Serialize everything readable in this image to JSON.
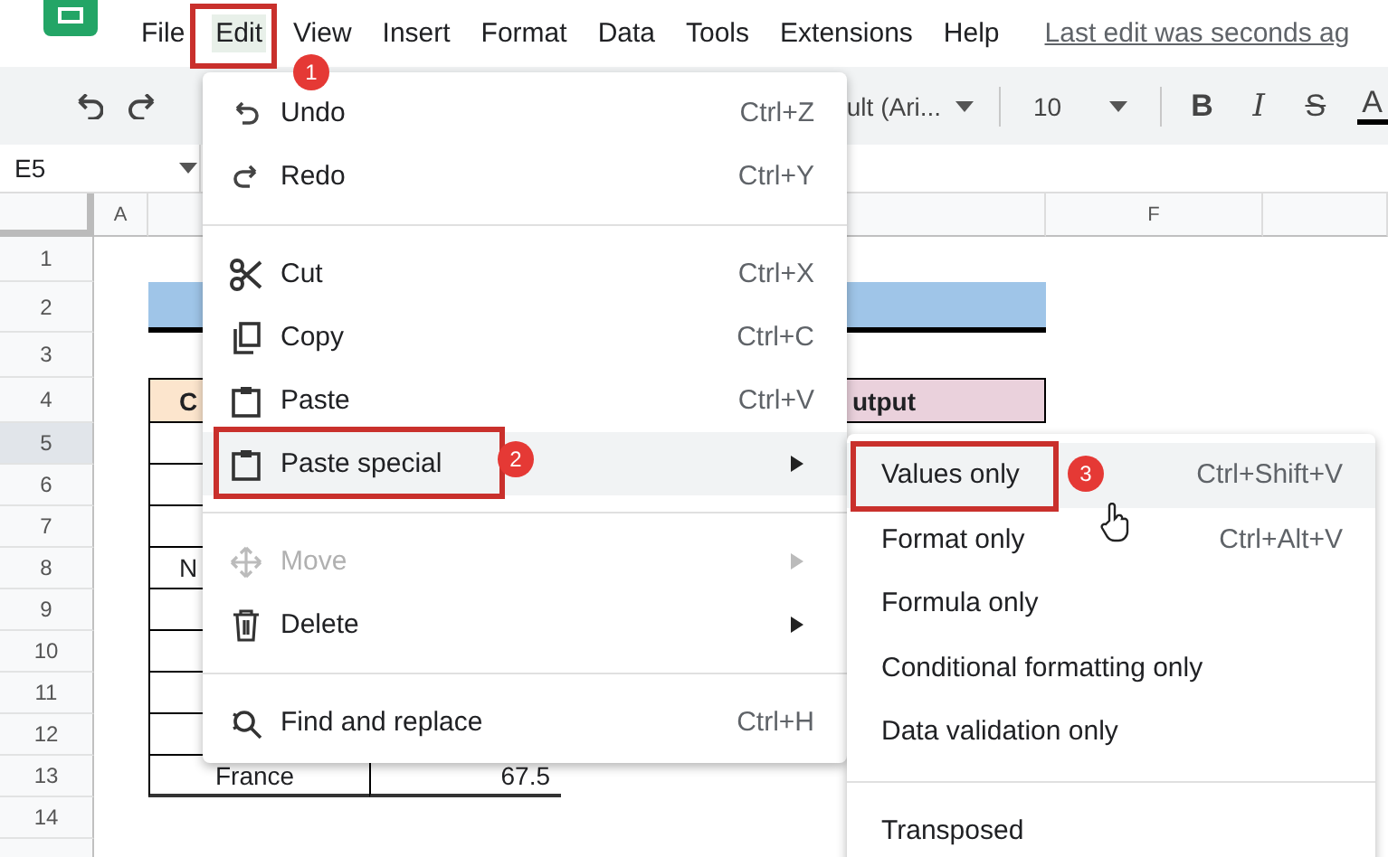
{
  "menu_bar": [
    {
      "label": "File",
      "selected": false
    },
    {
      "label": "Edit",
      "selected": true
    },
    {
      "label": "View",
      "selected": false
    },
    {
      "label": "Insert",
      "selected": false
    },
    {
      "label": "Format",
      "selected": false
    },
    {
      "label": "Data",
      "selected": false
    },
    {
      "label": "Tools",
      "selected": false
    },
    {
      "label": "Extensions",
      "selected": false
    },
    {
      "label": "Help",
      "selected": false
    }
  ],
  "last_edit": "Last edit was seconds ag",
  "toolbar": {
    "font": "ult (Ari...",
    "font_size": "10",
    "bold": "B",
    "italic": "I",
    "strikethrough": "S",
    "text_color": "A"
  },
  "name_box": "E5",
  "column_headers": [
    {
      "label": "A",
      "selected": false
    },
    {
      "label": "F",
      "selected": false
    }
  ],
  "rows": [
    {
      "number": "1",
      "selected": false
    },
    {
      "number": "2",
      "selected": false
    },
    {
      "number": "3",
      "selected": false
    },
    {
      "number": "4",
      "selected": false,
      "cells": [
        {
          "kind": "header_left",
          "text": "C"
        },
        {
          "kind": "header_right",
          "text": "utput"
        }
      ]
    },
    {
      "number": "5",
      "selected": true
    },
    {
      "number": "6",
      "selected": false
    },
    {
      "number": "7",
      "selected": false
    },
    {
      "number": "8",
      "selected": false,
      "cells": [
        {
          "kind": "country",
          "text": "N"
        }
      ]
    },
    {
      "number": "9",
      "selected": false
    },
    {
      "number": "10",
      "selected": false
    },
    {
      "number": "11",
      "selected": false
    },
    {
      "number": "12",
      "selected": false
    },
    {
      "number": "13",
      "selected": false,
      "cells": [
        {
          "kind": "country",
          "text": "France"
        },
        {
          "kind": "value",
          "text": "67.5"
        }
      ]
    },
    {
      "number": "14",
      "selected": false
    }
  ],
  "edit_menu": [
    {
      "kind": "item",
      "label": "Undo",
      "shortcut": "Ctrl+Z",
      "selected": false,
      "disabled": false,
      "submenu": false
    },
    {
      "kind": "item",
      "label": "Redo",
      "shortcut": "Ctrl+Y",
      "selected": false,
      "disabled": false,
      "submenu": false
    },
    {
      "kind": "separator"
    },
    {
      "kind": "item",
      "label": "Cut",
      "shortcut": "Ctrl+X",
      "selected": false,
      "disabled": false,
      "submenu": false
    },
    {
      "kind": "item",
      "label": "Copy",
      "shortcut": "Ctrl+C",
      "selected": false,
      "disabled": false,
      "submenu": false
    },
    {
      "kind": "item",
      "label": "Paste",
      "shortcut": "Ctrl+V",
      "selected": false,
      "disabled": false,
      "submenu": false
    },
    {
      "kind": "item",
      "label": "Paste special",
      "selected": true,
      "disabled": false,
      "submenu": true
    },
    {
      "kind": "separator"
    },
    {
      "kind": "item",
      "label": "Move",
      "selected": false,
      "disabled": true,
      "submenu": true
    },
    {
      "kind": "item",
      "label": "Delete",
      "selected": false,
      "disabled": false,
      "submenu": true
    },
    {
      "kind": "separator"
    },
    {
      "kind": "item",
      "label": "Find and replace",
      "shortcut": "Ctrl+H",
      "selected": false,
      "disabled": false,
      "submenu": false
    }
  ],
  "paste_special_menu": [
    {
      "kind": "item",
      "label": "Values only",
      "shortcut": "Ctrl+Shift+V",
      "selected": true
    },
    {
      "kind": "item",
      "label": "Format only",
      "shortcut": "Ctrl+Alt+V",
      "selected": false
    },
    {
      "kind": "item",
      "label": "Formula only",
      "selected": false
    },
    {
      "kind": "item",
      "label": "Conditional formatting only",
      "selected": false
    },
    {
      "kind": "item",
      "label": "Data validation only",
      "selected": false
    },
    {
      "kind": "separator"
    },
    {
      "kind": "item",
      "label": "Transposed",
      "selected": false
    }
  ],
  "callouts": [
    "1",
    "2",
    "3"
  ]
}
